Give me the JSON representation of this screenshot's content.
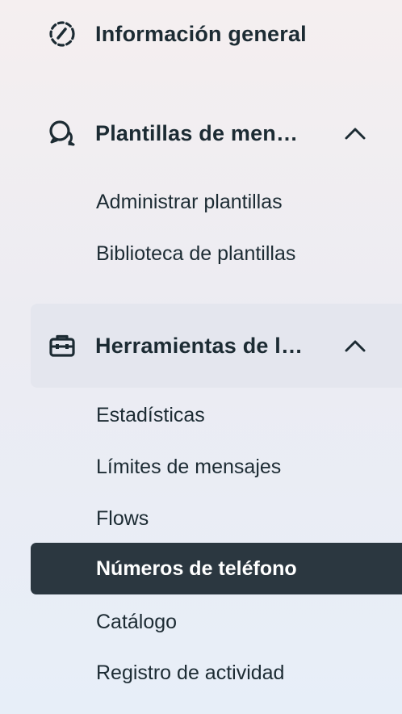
{
  "nav": {
    "overview": {
      "label": "Información general",
      "icon": "gauge-icon"
    },
    "templates": {
      "label": "Plantillas de men…",
      "icon": "chat-bubbles-icon",
      "expanded": true,
      "items": [
        {
          "label": "Administrar plantillas"
        },
        {
          "label": "Biblioteca de plantillas"
        }
      ]
    },
    "tools": {
      "label": "Herramientas de l…",
      "icon": "briefcase-icon",
      "expanded": true,
      "items": [
        {
          "label": "Estadísticas"
        },
        {
          "label": "Límites de mensajes"
        },
        {
          "label": "Flows"
        },
        {
          "label": "Números de teléfono",
          "selected": true
        },
        {
          "label": "Catálogo"
        },
        {
          "label": "Registro de actividad"
        }
      ]
    }
  },
  "colors": {
    "text": "#1c2b33",
    "selected_bg": "#2b3740",
    "active_section_bg": "#e4e6ee"
  }
}
